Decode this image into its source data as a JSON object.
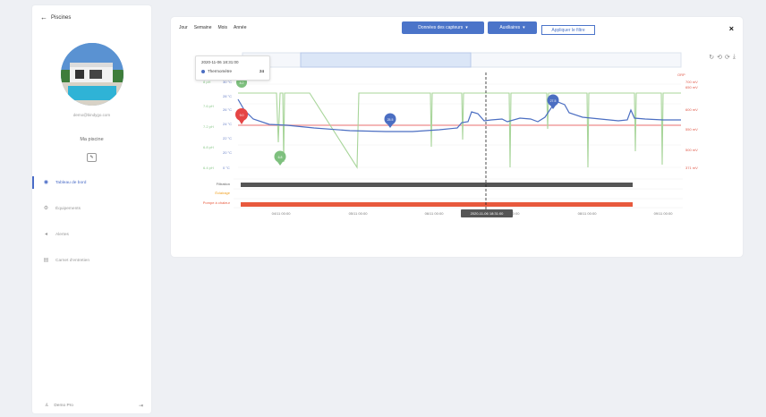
{
  "sidebar": {
    "back_label": "Piscines",
    "email": "demo@bindygo.com",
    "pool_name": "Ma piscine",
    "items": [
      {
        "label": "Tableau de bord",
        "icon": "dashboard-icon",
        "active": true
      },
      {
        "label": "Équipements",
        "icon": "equipment-icon",
        "active": false
      },
      {
        "label": "Alertes",
        "icon": "bell-icon",
        "active": false
      },
      {
        "label": "Carnet d'entretien",
        "icon": "notebook-icon",
        "active": false
      }
    ],
    "user_name": "Demo Pro"
  },
  "toolbar": {
    "periods": [
      "Jour",
      "Semaine",
      "Mois",
      "Année"
    ],
    "sensors_label": "Données des capteurs",
    "aux_label": "Auxiliaires",
    "filter_label": "Appliquer le filtre",
    "close": "×"
  },
  "tooltip": {
    "time": "2020-11-06 18:31:00",
    "series": "Thermomètre",
    "value": "24"
  },
  "chart_data": {
    "type": "line",
    "x_labels": [
      "04/11 00:00",
      "05/11 00:00",
      "06/11 00:00",
      "07/11 00:00",
      "08/11 00:00",
      "09/11 00:00"
    ],
    "crosshair_label": "2020-11-06 18:31:00",
    "left_axis": [
      "8 pH",
      "7.6 pH",
      "7.2 pH",
      "6.8 pH",
      "6.4 pH"
    ],
    "temp_axis": [
      "30 °C",
      "28 °C",
      "26 °C",
      "24 °C",
      "22 °C",
      "20 °C",
      "0 °C"
    ],
    "right_title": "ORP",
    "right_axis": [
      "700 mV",
      "650 mV",
      "600 mV",
      "550 mV",
      "500 mV",
      "371 mV"
    ],
    "aux_labels": [
      "Filtration",
      "Éclairage",
      "Pompe à chaleur"
    ],
    "markers": [
      {
        "label": "8.2",
        "color": "#7ec07e"
      },
      {
        "label": "9.0",
        "color": "#e54545"
      },
      {
        "label": "6.8",
        "color": "#7ec07e"
      },
      {
        "label": "25.5",
        "color": "#4b6ec2"
      },
      {
        "label": "27.5",
        "color": "#4b6ec2"
      }
    ],
    "colors": {
      "temperature": "#4b6ec2",
      "ph": "#a8d59a",
      "orp_threshold": "#f2a0a0",
      "filtration": "#555555",
      "heat_pump": "#e8593d",
      "lighting": "#f0a020"
    }
  }
}
